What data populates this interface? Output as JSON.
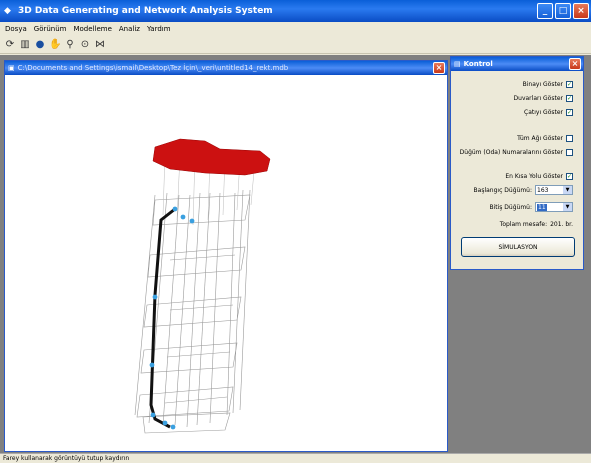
{
  "app": {
    "title": "3D Data Generating and Network Analysis System",
    "icon": "app-icon",
    "window_buttons": {
      "minimize": "_",
      "maximize": "□",
      "close": "×"
    }
  },
  "menu": [
    "Dosya",
    "Görünüm",
    "Modelleme",
    "Analiz",
    "Yardım"
  ],
  "toolbar_icons": [
    "rotate-icon",
    "chart-icon",
    "globe-icon",
    "pan-icon",
    "zoom-icon",
    "zoom-target-icon",
    "network-icon"
  ],
  "child_window": {
    "title": "C:\\Documents and Settings\\ismail\\Desktop\\Tez İçin\\_veri\\untitled14_rekt.mdb",
    "close": "×"
  },
  "kontrol": {
    "title": "Kontrol",
    "close": "×",
    "options": {
      "binayi_goster": {
        "label": "Binayı Göster",
        "checked": true
      },
      "duvarlari_goster": {
        "label": "Duvarları Göster",
        "checked": true
      },
      "catiyi_goster": {
        "label": "Çatıyı Göster",
        "checked": true
      },
      "tum_agi_goster": {
        "label": "Tüm Ağı Göster",
        "checked": false
      },
      "dugum_numaralari": {
        "label": "Düğüm (Oda) Numaralarını Göster",
        "checked": false
      },
      "en_kisa_yolu": {
        "label": "En Kısa Yolu Göster",
        "checked": true
      }
    },
    "check_mark": "✓",
    "baslangic": {
      "label": "Başlangıç Düğümü:",
      "value": "163"
    },
    "bitis": {
      "label": "Bitiş Düğümü:",
      "value": "11"
    },
    "mesafe": {
      "label": "Toplam mesafe:",
      "value": "201. br."
    },
    "sim_button": "SİMULASYON"
  },
  "status": "Farey kullanarak görüntüyü tutup kaydırın",
  "colors": {
    "roof": "#cc1111",
    "path": "#111111",
    "node": "#3aa0e0",
    "frame": "#9a9a9a"
  }
}
